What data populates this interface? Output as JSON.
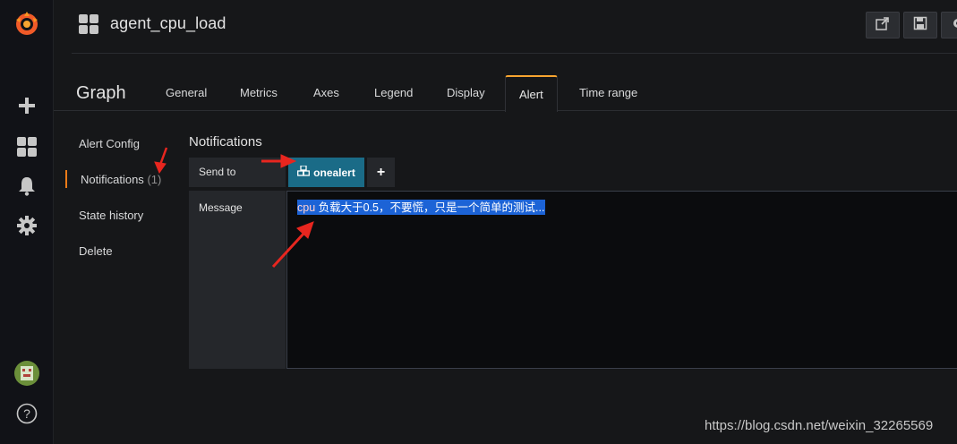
{
  "app": {
    "logo": "grafana-logo"
  },
  "siderail": {
    "items": [
      {
        "icon": "plus-icon"
      },
      {
        "icon": "dashboards-icon"
      },
      {
        "icon": "bell-icon"
      },
      {
        "icon": "gear-icon"
      },
      {
        "icon": "user-avatar"
      },
      {
        "icon": "help-icon",
        "glyph": "?"
      }
    ]
  },
  "topbar": {
    "title": "agent_cpu_load",
    "buttons": [
      {
        "icon": "share-icon"
      },
      {
        "icon": "save-icon"
      },
      {
        "icon": "settings-icon"
      }
    ]
  },
  "editor": {
    "panel_type": "Graph",
    "tabs": [
      {
        "label": "General"
      },
      {
        "label": "Metrics"
      },
      {
        "label": "Axes"
      },
      {
        "label": "Legend"
      },
      {
        "label": "Display"
      },
      {
        "label": "Alert",
        "active": true
      },
      {
        "label": "Time range"
      }
    ]
  },
  "alert_menu": {
    "items": [
      {
        "label": "Alert Config"
      },
      {
        "label": "Notifications",
        "count": "(1)",
        "active": true
      },
      {
        "label": "State history"
      },
      {
        "label": "Delete"
      }
    ]
  },
  "notifications": {
    "title": "Notifications",
    "send_to_label": "Send to",
    "channel": {
      "name": "onealert",
      "icon": "cubes-icon"
    },
    "add_label": "+",
    "message_label": "Message",
    "message_value_prefix": "cpu",
    "message_value_rest": " 负载大于0.5，不要慌，只是一个简单的测试..."
  },
  "watermark": "https://blog.csdn.net/weixin_32265569",
  "colors": {
    "accent": "#eb7b18",
    "chip": "#1a6b87",
    "selection": "#1c63d6",
    "annotation_arrow": "#e8261f"
  }
}
